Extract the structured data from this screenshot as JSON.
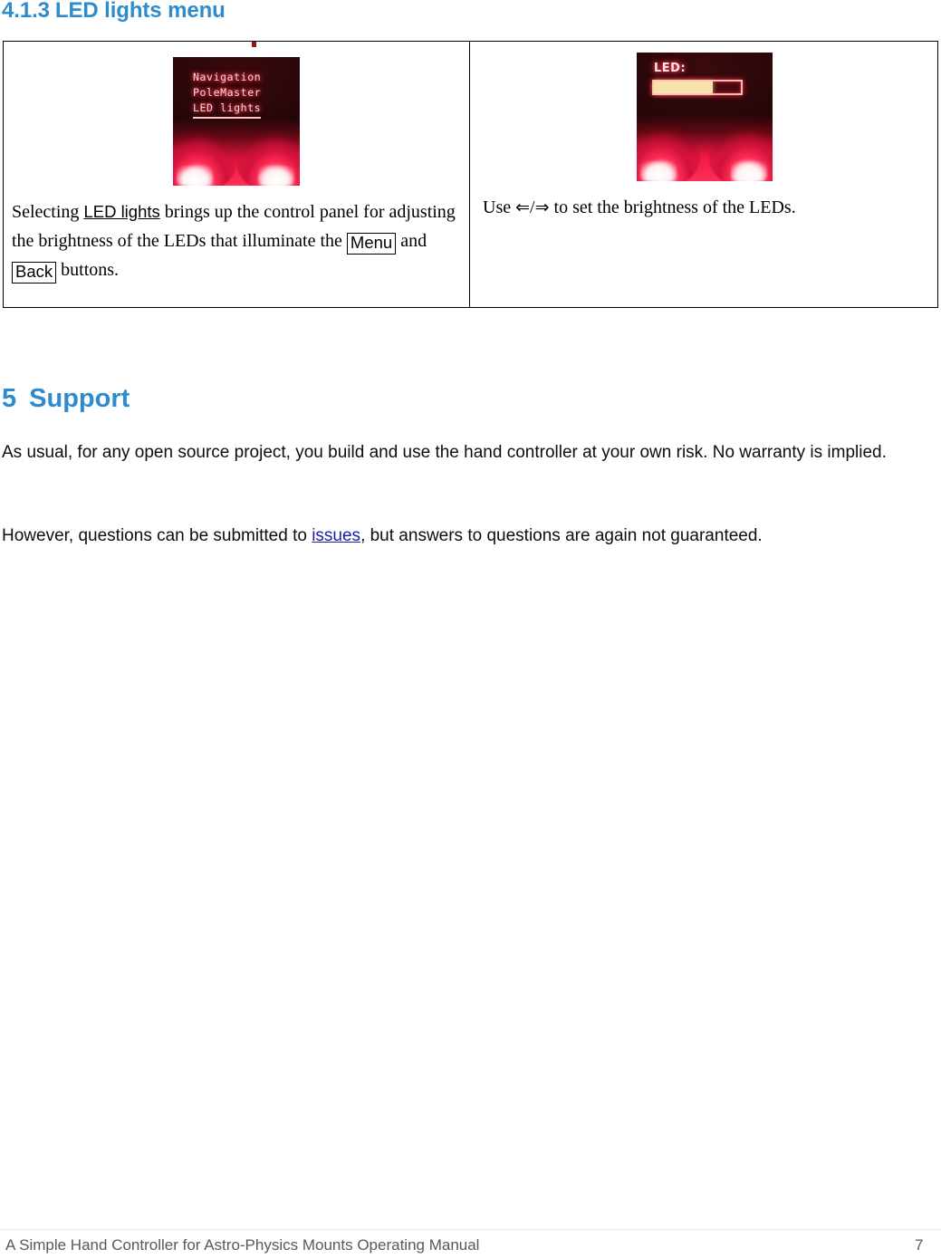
{
  "section_heading": {
    "number": "4.1.3",
    "title": "LED lights menu"
  },
  "comparison_table": {
    "left_cell": {
      "lcd_screen": {
        "type": "menu-list",
        "lines": [
          "Navigation",
          "PoleMaster",
          "LED lights"
        ],
        "selected_line": "LED lights"
      },
      "caption_parts": {
        "before": "Selecting ",
        "ui_item": "LED lights",
        "middle": " brings up the control panel for adjusting the brightness of the LEDs that illuminate the ",
        "key1": "Menu",
        "conjunction": " and ",
        "key2": "Back",
        "after": " buttons."
      }
    },
    "right_cell": {
      "lcd_screen": {
        "type": "brightness-slider",
        "label": "LED:",
        "fill_percent": 68
      },
      "caption_parts": {
        "before": "Use ",
        "left_arrow": "⇐",
        "separator": "/",
        "right_arrow": "⇒",
        "after": " to set the brightness of the LEDs."
      }
    }
  },
  "support_section": {
    "number": "5",
    "title": "Support",
    "paragraph_1": "As usual, for any open source project, you build and use the hand controller at your own risk. No warranty is implied.",
    "paragraph_2": {
      "before": "However, questions can be submitted to ",
      "link_text": "issues",
      "after": ", but answers to questions are again not guaranteed."
    }
  },
  "footer": {
    "document_title": "A Simple Hand Controller for Astro-Physics Mounts Operating Manual",
    "page_number": "7"
  },
  "colors": {
    "heading_blue": "#2e8ccd",
    "link_blue": "#1b1ba8",
    "footer_gray": "#585858",
    "footer_rule": "#f3ead9",
    "lcd_red": "#ff2e57",
    "lcd_bar_fill": "#f7e2ac"
  }
}
